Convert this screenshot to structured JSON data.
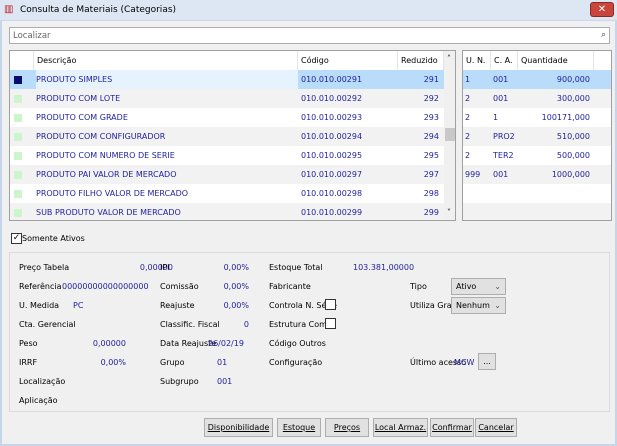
{
  "window": {
    "title": "Consulta de Materiais (Categorias)",
    "close": "✕",
    "icon": "app-logo-icon"
  },
  "search": {
    "placeholder": "Localizar",
    "icon": "magnifier-icon"
  },
  "materials": {
    "columns": [
      "Descrição",
      "Código",
      "Reduzido"
    ],
    "rows": [
      {
        "desc": "PRODUTO SIMPLES",
        "code": "010.010.00291",
        "red": "291"
      },
      {
        "desc": "PRODUTO COM LOTE",
        "code": "010.010.00292",
        "red": "292"
      },
      {
        "desc": "PRODUTO COM GRADE",
        "code": "010.010.00293",
        "red": "293"
      },
      {
        "desc": "PRODUTO COM CONFIGURADOR",
        "code": "010.010.00294",
        "red": "294"
      },
      {
        "desc": "PRODUTO COM NUMERO DE SERIE",
        "code": "010.010.00295",
        "red": "295"
      },
      {
        "desc": "PRODUTO PAI VALOR DE MERCADO",
        "code": "010.010.00297",
        "red": "297"
      },
      {
        "desc": "PRODUTO FILHO VALOR DE MERCADO",
        "code": "010.010.00298",
        "red": "298"
      },
      {
        "desc": "SUB PRODUTO VALOR DE MERCADO",
        "code": "010.010.00299",
        "red": "299"
      }
    ],
    "selected_index": 0,
    "scroll_up": "˄",
    "scroll_down": "˅"
  },
  "stock": {
    "columns": [
      "U. N.",
      "C. A.",
      "Quantidade"
    ],
    "rows": [
      {
        "un": "1",
        "ca": "001",
        "qty": "900,000"
      },
      {
        "un": "2",
        "ca": "001",
        "qty": "300,000"
      },
      {
        "un": "2",
        "ca": "1",
        "qty": "100171,000"
      },
      {
        "un": "2",
        "ca": "PRO2",
        "qty": "510,000"
      },
      {
        "un": "2",
        "ca": "TER2",
        "qty": "500,000"
      },
      {
        "un": "999",
        "ca": "001",
        "qty": "1000,000"
      }
    ]
  },
  "only_active": {
    "label": "Somente Ativos",
    "checked": true
  },
  "details": {
    "preco_tabela": {
      "label": "Preço Tabela",
      "value": "0,00000"
    },
    "referencia": {
      "label": "Referência",
      "value": "00000000000000000"
    },
    "u_medida": {
      "label": "U. Medida",
      "value": "PC"
    },
    "cta_gerencial": {
      "label": "Cta. Gerencial"
    },
    "peso": {
      "label": "Peso",
      "value": "0,00000"
    },
    "irrf": {
      "label": "IRRF",
      "value": "0,00%"
    },
    "localizacao": {
      "label": "Localização"
    },
    "aplicacao": {
      "label": "Aplicação"
    },
    "ipi": {
      "label": "IPI",
      "value": "0,00%"
    },
    "comissao": {
      "label": "Comissão",
      "value": "0,00%"
    },
    "reajuste": {
      "label": "Reajuste",
      "value": "0,00%"
    },
    "classif_fiscal": {
      "label": "Classific. Fiscal",
      "value": "0"
    },
    "data_reajuste": {
      "label": "Data Reajuste",
      "value": "26/02/19"
    },
    "grupo": {
      "label": "Grupo",
      "value": "01"
    },
    "subgrupo": {
      "label": "Subgrupo",
      "value": "001"
    },
    "estoque_total": {
      "label": "Estoque Total",
      "value": "103.381,00000"
    },
    "fabricante": {
      "label": "Fabricante"
    },
    "controla_serie": {
      "label": "Controla N. Série",
      "checked": false
    },
    "estrutura_com": {
      "label": "Estrutura Com.",
      "checked": false
    },
    "codigo_outros": {
      "label": "Código Outros"
    },
    "configuracao": {
      "label": "Configuração"
    },
    "tipo": {
      "label": "Tipo",
      "value": "Ativo"
    },
    "utiliza_grade": {
      "label": "Utiliza Grade",
      "value": "Nenhum"
    },
    "ultimo_acesso": {
      "label": "Último acesso",
      "value": "MCW",
      "button": "..."
    }
  },
  "buttons": {
    "disponibilidade": "Disponibilidade",
    "estoque": "Estoque",
    "precos": "Preços",
    "local": "Local Armaz.",
    "confirmar": "Confirmar",
    "cancelar": "Cancelar"
  },
  "colors": {
    "value_text": "#1e1ea0",
    "selected_row": "#b9dcfa",
    "indicator_selected": "#0a0a70",
    "indicator": "#ccf5cc"
  }
}
